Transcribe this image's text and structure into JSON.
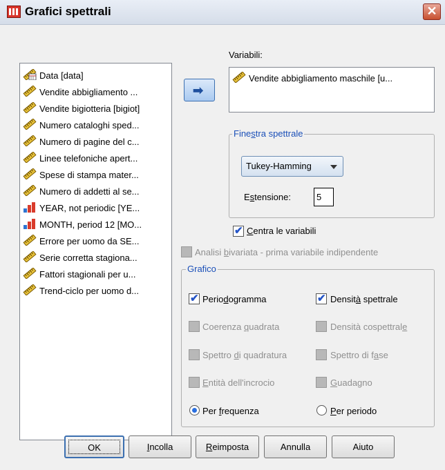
{
  "window": {
    "title": "Grafici spettrali",
    "close_glyph": "✕"
  },
  "source_list": {
    "items": [
      {
        "label": "Data [data]",
        "icon": "date-ruler-icon"
      },
      {
        "label": "Vendite abbigliamento ...",
        "icon": "scale-ruler-icon"
      },
      {
        "label": "Vendite bigiotteria [bigiot]",
        "icon": "scale-ruler-icon"
      },
      {
        "label": "Numero cataloghi sped...",
        "icon": "scale-ruler-icon"
      },
      {
        "label": "Numero di pagine del c...",
        "icon": "scale-ruler-icon"
      },
      {
        "label": "Linee telefoniche apert...",
        "icon": "scale-ruler-icon"
      },
      {
        "label": "Spese di stampa mater...",
        "icon": "scale-ruler-icon"
      },
      {
        "label": "Numero di addetti al se...",
        "icon": "scale-ruler-icon"
      },
      {
        "label": "YEAR, not periodic [YE...",
        "icon": "ordinal-bars-icon"
      },
      {
        "label": "MONTH, period 12 [MO...",
        "icon": "ordinal-bars-icon"
      },
      {
        "label": "Errore per uomo da SE...",
        "icon": "scale-ruler-icon"
      },
      {
        "label": "Serie corretta stagiona...",
        "icon": "scale-ruler-icon"
      },
      {
        "label": "Fattori stagionali per u...",
        "icon": "scale-ruler-icon"
      },
      {
        "label": "Trend-ciclo per uomo d...",
        "icon": "scale-ruler-icon"
      }
    ]
  },
  "variables": {
    "label": "Variabili:",
    "items": [
      {
        "label": "Vendite abbigliamento maschile [u...",
        "icon": "scale-ruler-icon"
      }
    ]
  },
  "spectral_window": {
    "legend_pre": "Fine",
    "legend_u": "s",
    "legend_post": "tra spettrale",
    "selected": "Tukey-Hamming",
    "extension_pre": "E",
    "extension_u": "s",
    "extension_post": "tensione:",
    "extension_value": "5"
  },
  "center_variables": {
    "label_u": "C",
    "label_rest": "entra le variabili",
    "checked": true
  },
  "bivariate": {
    "label_pre": "Analisi ",
    "label_u": "b",
    "label_rest": "ivariata - prima variabile indipendente",
    "enabled": false
  },
  "plot_group": {
    "legend": "Grafico",
    "periodogram": {
      "pre": "Perio",
      "u": "d",
      "post": "ogramma",
      "checked": true
    },
    "spectral_density": {
      "pre": "Densit",
      "u": "à",
      "post": " spettrale",
      "checked": true
    },
    "squared_coherence": {
      "pre": "Coerenza ",
      "u": "q",
      "post": "uadrata",
      "enabled": false
    },
    "cospectral_density": {
      "pre": "Densità cospettral",
      "u": "e",
      "post": "",
      "enabled": false
    },
    "quadrature_spectrum": {
      "pre": "Spettro ",
      "u": "d",
      "post": "i quadratura",
      "enabled": false
    },
    "phase_spectrum": {
      "pre": "Spettro di f",
      "u": "a",
      "post": "se",
      "enabled": false
    },
    "cross_amplitude": {
      "pre": "",
      "u": "E",
      "post": "ntità dell'incrocio",
      "enabled": false
    },
    "gain": {
      "pre": "",
      "u": "G",
      "post": "uadagno",
      "enabled": false
    },
    "by_frequency": {
      "pre": "Per ",
      "u": "f",
      "post": "requenza",
      "selected": true
    },
    "by_period": {
      "pre": "",
      "u": "P",
      "post": "er periodo",
      "selected": false
    }
  },
  "buttons": {
    "ok": "OK",
    "paste_u": "I",
    "paste_rest": "ncolla",
    "reset_u": "R",
    "reset_rest": "eimposta",
    "cancel": "Annulla",
    "help": "Aiuto"
  },
  "colors": {
    "group_legend": "#1a4fb8",
    "check": "#2454c6",
    "disabled_text": "#8f8f8f"
  }
}
